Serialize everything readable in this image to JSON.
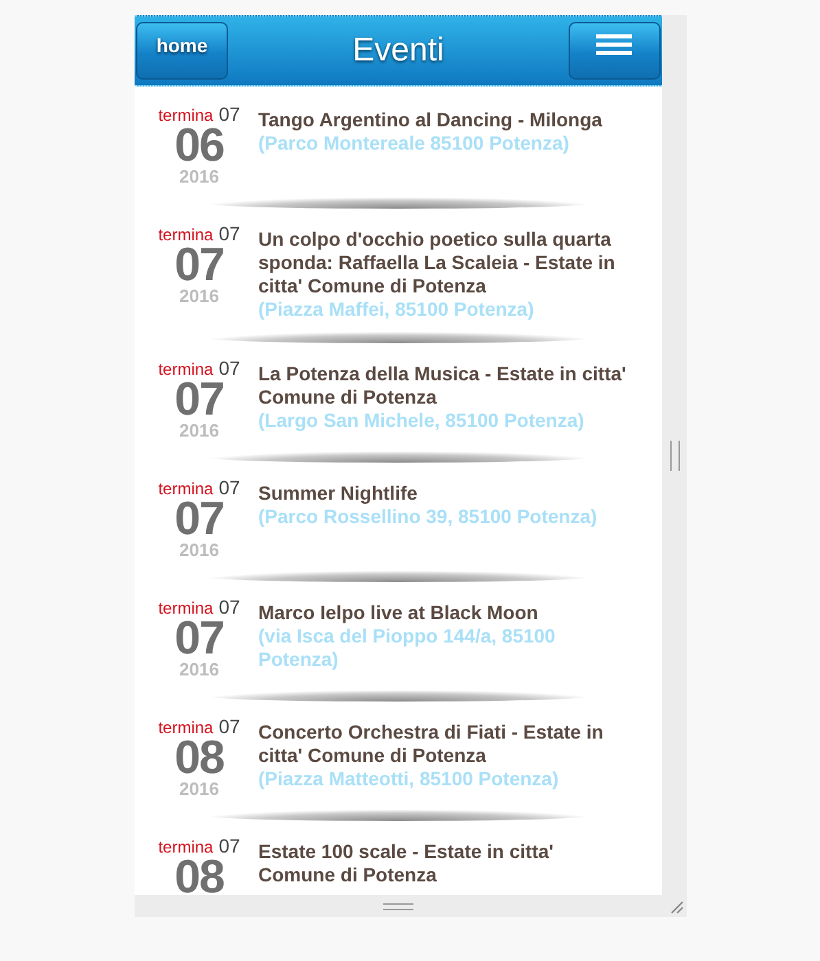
{
  "header": {
    "home_button": "home",
    "title": "Eventi"
  },
  "events": [
    {
      "end_label": "termina",
      "end_month": "07",
      "day": "06",
      "year": "2016",
      "title": "Tango Argentino al Dancing - Milonga",
      "place": "(Parco Montereale 85100 Potenza)"
    },
    {
      "end_label": "termina",
      "end_month": "07",
      "day": "07",
      "year": "2016",
      "title": "Un colpo d'occhio poetico sulla quarta sponda: Raffaella La Scaleia - Estate in citta' Comune di Potenza",
      "place": "(Piazza Maffei, 85100 Potenza)"
    },
    {
      "end_label": "termina",
      "end_month": "07",
      "day": "07",
      "year": "2016",
      "title": "La Potenza della Musica - Estate in citta' Comune di Potenza",
      "place": "(Largo San Michele, 85100 Potenza)"
    },
    {
      "end_label": "termina",
      "end_month": "07",
      "day": "07",
      "year": "2016",
      "title": "Summer Nightlife",
      "place": "(Parco Rossellino 39, 85100 Potenza)"
    },
    {
      "end_label": "termina",
      "end_month": "07",
      "day": "07",
      "year": "2016",
      "title": "Marco Ielpo live at Black Moon",
      "place": "(via Isca del Pioppo 144/a, 85100 Potenza)"
    },
    {
      "end_label": "termina",
      "end_month": "07",
      "day": "08",
      "year": "2016",
      "title": "Concerto Orchestra di Fiati - Estate in citta' Comune di Potenza",
      "place": "(Piazza Matteotti, 85100 Potenza)"
    },
    {
      "end_label": "termina",
      "end_month": "07",
      "day": "08",
      "title": "Estate 100 scale - Estate in citta' Comune di Potenza"
    }
  ]
}
